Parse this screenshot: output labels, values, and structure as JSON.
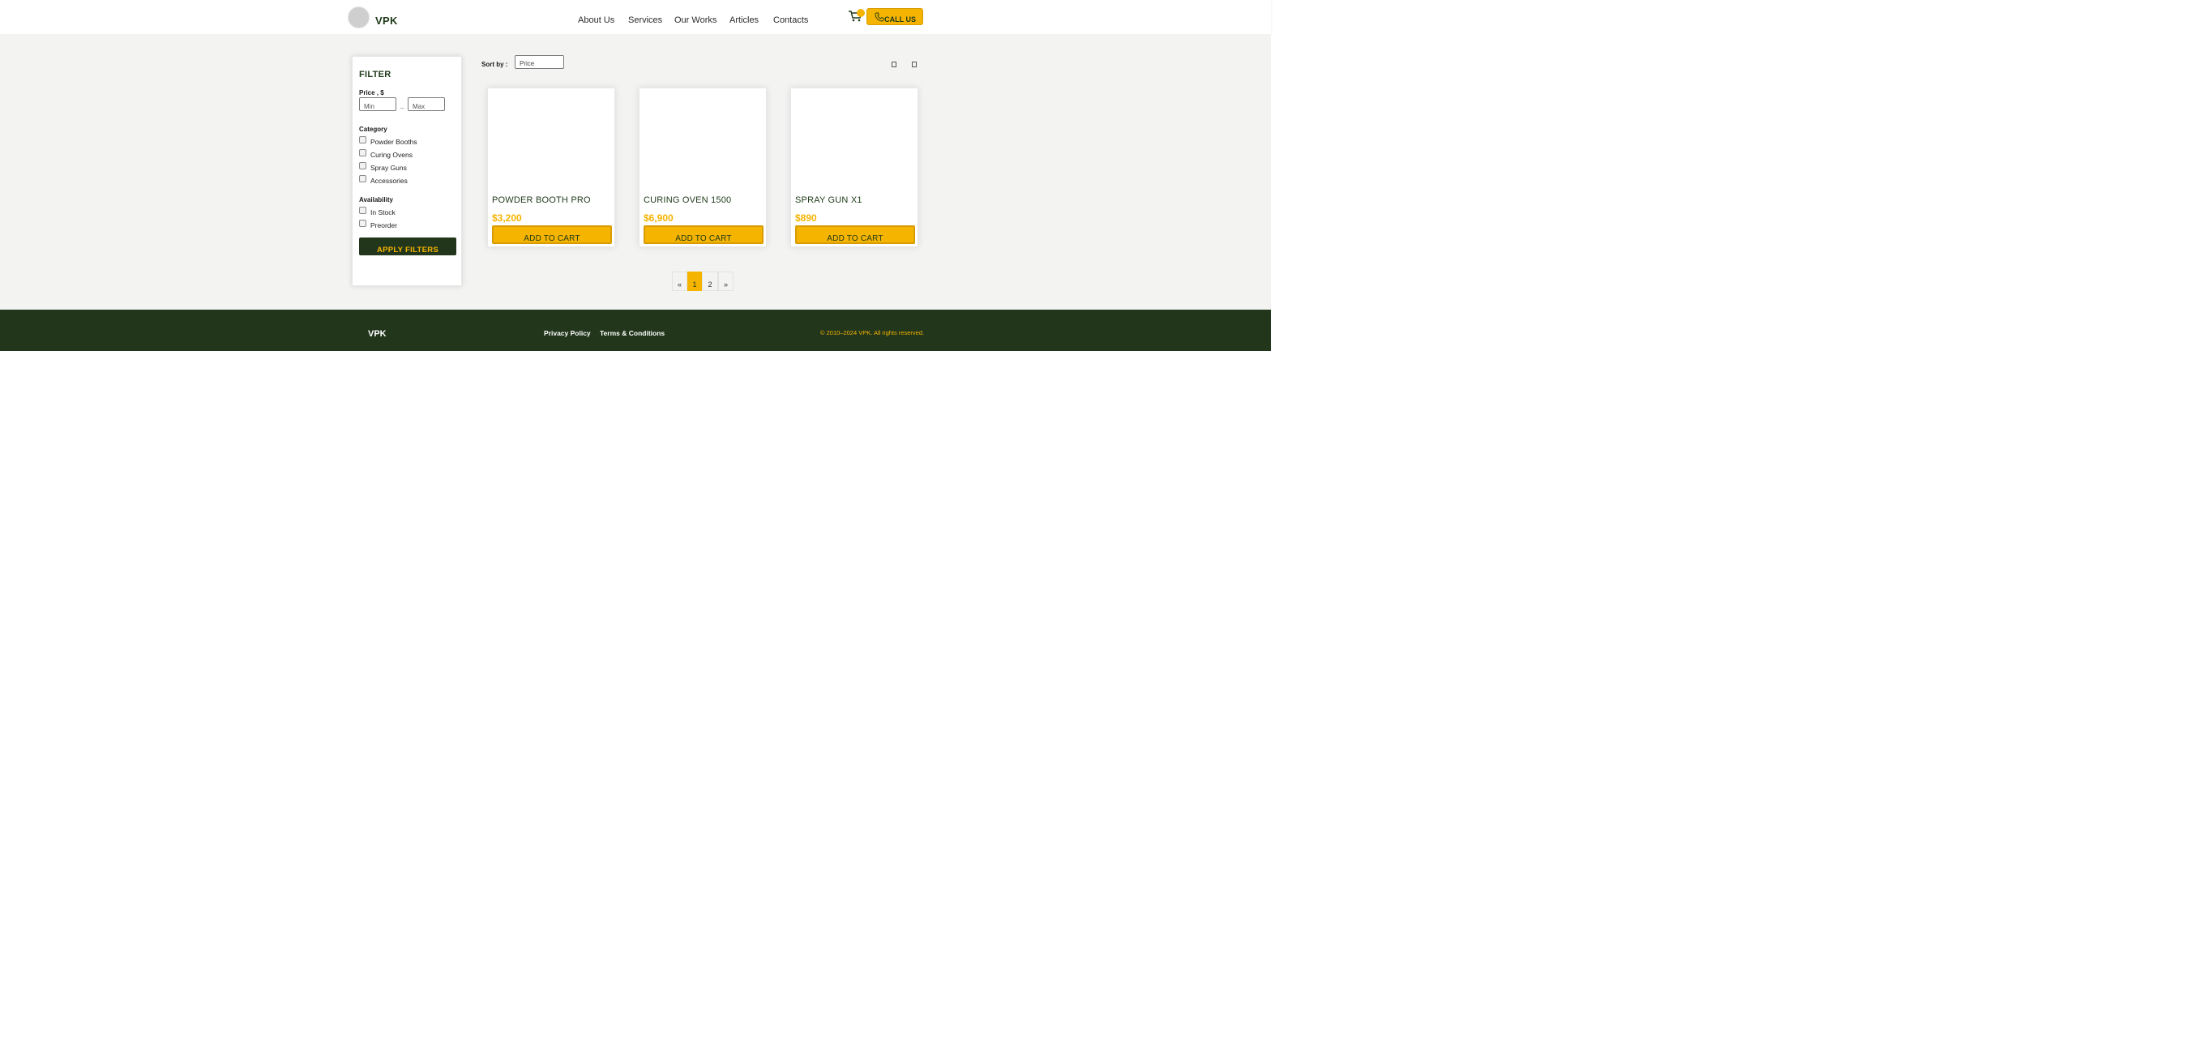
{
  "brand": {
    "name": "VPK"
  },
  "nav": {
    "items": [
      {
        "label": "About Us"
      },
      {
        "label": "Services"
      },
      {
        "label": "Our Works"
      },
      {
        "label": "Articles"
      },
      {
        "label": "Contacts"
      }
    ],
    "call_label": "CALL US"
  },
  "filter": {
    "title": "FILTER",
    "price_label": "Price , $",
    "min_placeholder": "Min",
    "max_placeholder": "Max",
    "dash": "–",
    "category_label": "Category",
    "categories": [
      {
        "label": "Powder Booths"
      },
      {
        "label": "Curing Ovens"
      },
      {
        "label": "Spray Guns"
      },
      {
        "label": "Accessories"
      }
    ],
    "availability_label": "Availability",
    "availability": [
      {
        "label": "In Stock"
      },
      {
        "label": "Preorder"
      }
    ],
    "apply_label": "APPLY FILTERS"
  },
  "sort": {
    "label": "Sort  by :",
    "value": "Price"
  },
  "products": [
    {
      "title": "POWDER BOOTH PRO",
      "price": "$3,200",
      "button": "ADD TO CART"
    },
    {
      "title": "CURING OVEN 1500",
      "price": "$6,900",
      "button": "ADD TO CART"
    },
    {
      "title": "SPRAY GUN X1",
      "price": "$890",
      "button": "ADD TO CART"
    }
  ],
  "pagination": {
    "prev": "«",
    "pages": [
      "1",
      "2"
    ],
    "current": "1",
    "next": "»"
  },
  "footer": {
    "logo": "VPK",
    "links": [
      {
        "label": "Privacy Policy"
      },
      {
        "label": "Terms & Conditions"
      }
    ],
    "copyright": "© 2010–2024 VPK. All rights reserved."
  },
  "colors": {
    "accent": "#f5b400",
    "dark_green": "#22361c",
    "background": "#f3f3f2"
  }
}
